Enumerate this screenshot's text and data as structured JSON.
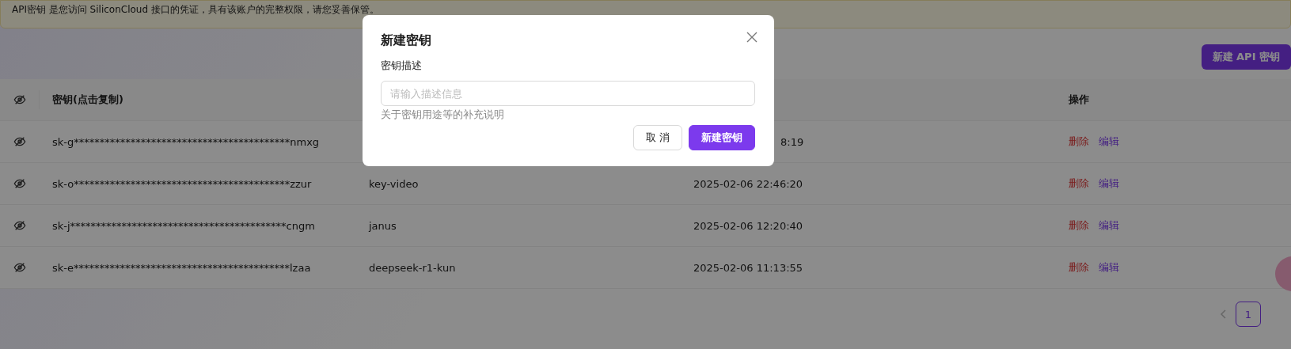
{
  "notice": "API密钥 是您访问 SiliconCloud 接口的凭证，具有该账户的完整权限，请您妥善保管。",
  "create_button": "新建 API 密钥",
  "table": {
    "columns": [
      {
        "kind": "toggle"
      },
      {
        "kind": "text",
        "label": "密钥(点击复制)"
      },
      {
        "kind": "text"
      },
      {
        "kind": "text"
      },
      {
        "kind": "text",
        "label": "操作"
      }
    ],
    "rows": [
      {
        "key": "sk-g******************************************nmxg",
        "created": "8:19",
        "actions": [
          "删除",
          "编辑"
        ]
      },
      {
        "key": "sk-o******************************************zzur",
        "name": "key-video",
        "created": "2025-02-06 22:46:20",
        "actions": [
          "删除",
          "编辑"
        ]
      },
      {
        "key": "sk-j******************************************cngm",
        "name": "janus",
        "created": "2025-02-06 12:20:40",
        "actions": [
          "删除",
          "编辑"
        ]
      },
      {
        "key": "sk-e******************************************lzaa",
        "name": "deepseek-r1-kun",
        "created": "2025-02-06 11:13:55",
        "actions": [
          "删除",
          "编辑"
        ]
      }
    ]
  },
  "pagination": [
    {
      "label": "1",
      "selected": true
    }
  ],
  "dialog": {
    "title": "新建密钥",
    "field_label": "密钥描述",
    "placeholder": "请输入描述信息",
    "help": "关于密钥用途等的补充说明",
    "buttons": [
      {
        "kind": "default",
        "label": "取 消"
      },
      {
        "kind": "primary",
        "label": "新建密钥"
      }
    ]
  }
}
